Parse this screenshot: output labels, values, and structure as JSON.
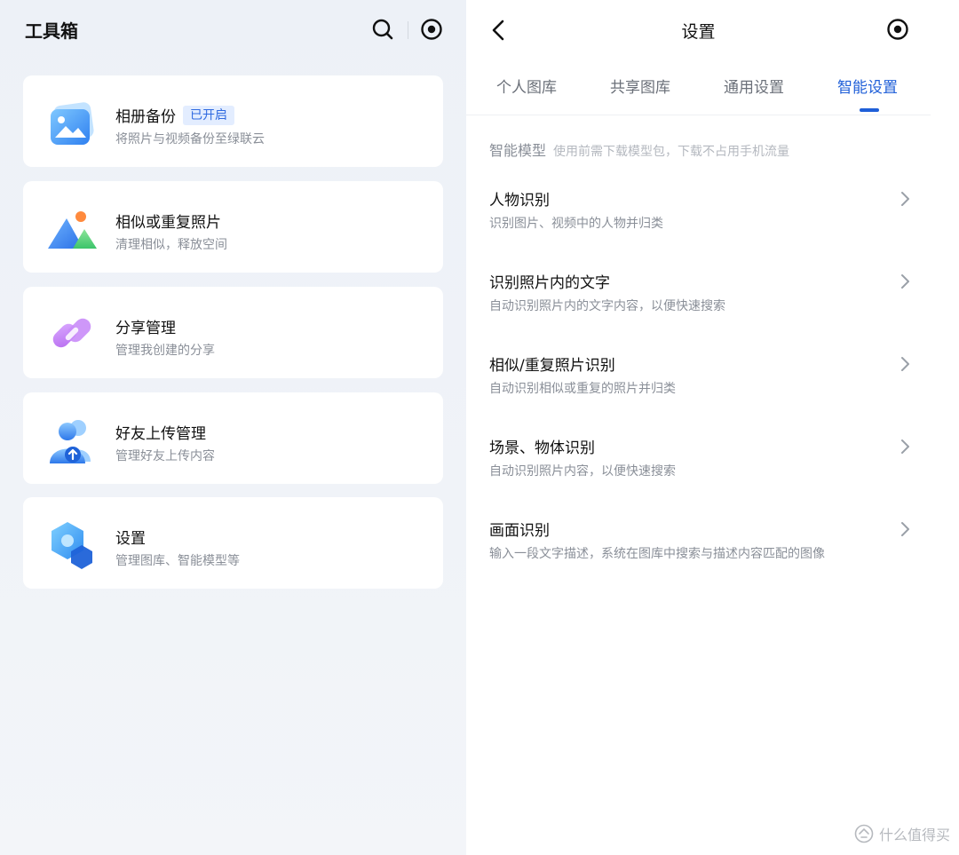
{
  "toolbox": {
    "title": "工具箱",
    "cards": [
      {
        "title": "相册备份",
        "badge": "已开启",
        "subtitle": "将照片与视频备份至绿联云",
        "icon": "photo-album-icon"
      },
      {
        "title": "相似或重复照片",
        "subtitle": "清理相似，释放空间",
        "icon": "mountain-sun-icon"
      },
      {
        "title": "分享管理",
        "subtitle": "管理我创建的分享",
        "icon": "link-icon"
      },
      {
        "title": "好友上传管理",
        "subtitle": "管理好友上传内容",
        "icon": "friend-upload-icon"
      },
      {
        "title": "设置",
        "subtitle": "管理图库、智能模型等",
        "icon": "hexagon-settings-icon"
      }
    ]
  },
  "settings": {
    "title": "设置",
    "tabs": [
      {
        "label": "个人图库",
        "active": false
      },
      {
        "label": "共享图库",
        "active": false
      },
      {
        "label": "通用设置",
        "active": false
      },
      {
        "label": "智能设置",
        "active": true
      }
    ],
    "section": {
      "title": "智能模型",
      "note": "使用前需下载模型包，下载不占用手机流量"
    },
    "items": [
      {
        "title": "人物识别",
        "subtitle": "识别图片、视频中的人物并归类"
      },
      {
        "title": "识别照片内的文字",
        "subtitle": "自动识别照片内的文字内容，以便快速搜索"
      },
      {
        "title": "相似/重复照片识别",
        "subtitle": "自动识别相似或重复的照片并归类"
      },
      {
        "title": "场景、物体识别",
        "subtitle": "自动识别照片内容，以便快速搜索"
      },
      {
        "title": "画面识别",
        "subtitle": "输入一段文字描述，系统在图库中搜索与描述内容匹配的图像"
      }
    ]
  },
  "watermark": {
    "text": "什么值得买"
  },
  "colors": {
    "accent": "#1f5fd8",
    "badge_bg": "#e3edff",
    "left_bg": "#edf1f7"
  }
}
